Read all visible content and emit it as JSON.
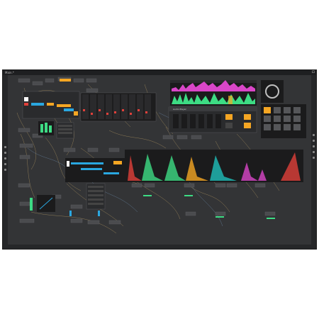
{
  "window": {
    "title": "Main.* ",
    "controls": "⊡"
  },
  "panels": {
    "audio_player_label": "Audio Player"
  },
  "colors": {
    "background": "#333436",
    "accent_orange": "#f5a623",
    "accent_blue": "#2aa7e0",
    "accent_green": "#3ddc84",
    "accent_pink": "#d946c8",
    "accent_red": "#e0403a",
    "accent_teal": "#1fb5b0"
  }
}
